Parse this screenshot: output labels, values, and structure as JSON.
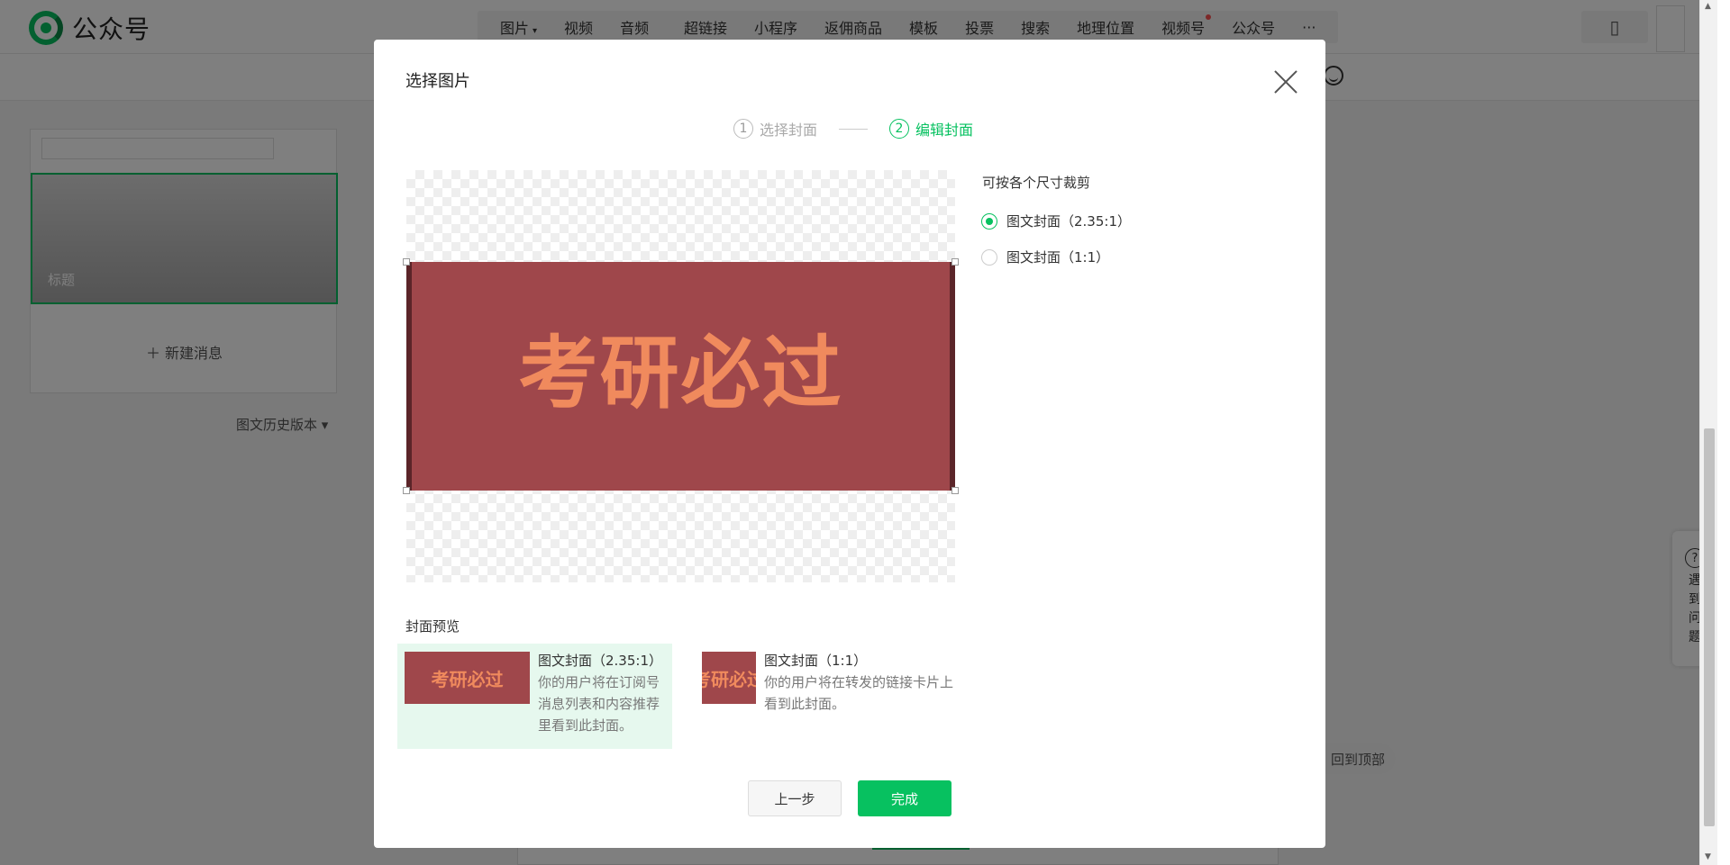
{
  "app": {
    "logo_text": "公众号"
  },
  "toolbar_left": [
    {
      "label": "图片",
      "caret": "▾"
    },
    {
      "label": "视频"
    },
    {
      "label": "音频"
    }
  ],
  "toolbar_right": [
    {
      "label": "超链接"
    },
    {
      "label": "小程序"
    },
    {
      "label": "返佣商品"
    },
    {
      "label": "模板"
    },
    {
      "label": "投票"
    },
    {
      "label": "搜索"
    },
    {
      "label": "地理位置"
    },
    {
      "label": "视频号",
      "badge": true
    },
    {
      "label": "公众号"
    },
    {
      "label": "···"
    }
  ],
  "left_panel": {
    "thumb_title": "标题",
    "new_message": "＋ 新建消息",
    "history": "图文历史版本 ▾"
  },
  "floating": {
    "help_icon": "?",
    "help_text": [
      "遇",
      "到",
      "问",
      "题"
    ],
    "back_to_top": "回到顶部"
  },
  "dialog": {
    "title": "选择图片",
    "steps": [
      {
        "num": "1",
        "label": "选择封面",
        "state": "inactive"
      },
      {
        "num": "2",
        "label": "编辑封面",
        "state": "active"
      }
    ],
    "image_text": "考研必过",
    "size_title": "可按各个尺寸裁剪",
    "options": [
      {
        "label": "图文封面（2.35:1）",
        "checked": true
      },
      {
        "label": "图文封面（1:1）",
        "checked": false
      }
    ],
    "preview_label": "封面预览",
    "previews": [
      {
        "name": "图文封面（2.35:1）",
        "desc": [
          "你的用户将在订阅号",
          "消息列表和内容推荐",
          "里看到此封面。"
        ]
      },
      {
        "name": "图文封面（1:1）",
        "desc": [
          "你的用户将在转发的链接卡片上",
          "看到此封面。"
        ]
      }
    ],
    "btn_prev": "上一步",
    "btn_done": "完成"
  },
  "colors": {
    "brand_green": "#07c160",
    "image_bg": "#9f474b",
    "image_text": "#f08a5d"
  }
}
